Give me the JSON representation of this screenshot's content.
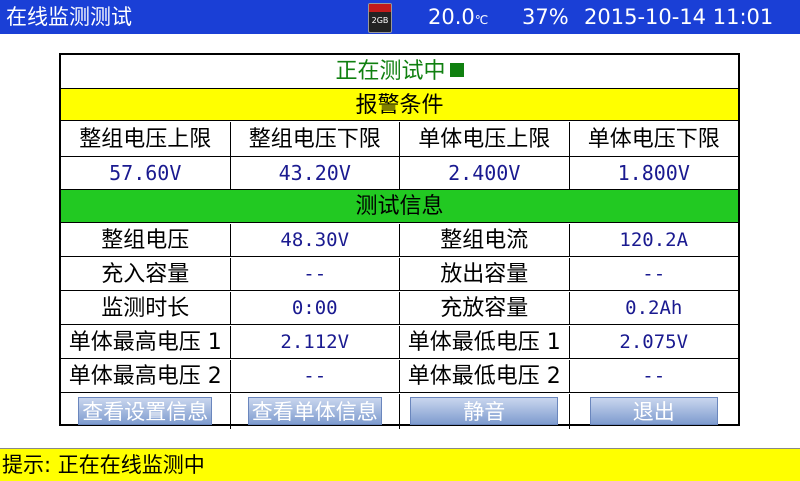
{
  "header": {
    "title": "在线监测测试",
    "temperature": "20.0",
    "temperature_unit": "℃",
    "humidity": "37%",
    "datetime": "2015-10-14 11:01",
    "sd_card_label": "2GB"
  },
  "status": {
    "text": "正在测试中",
    "indicator_color": "#108010"
  },
  "alarm_section": {
    "title": "报警条件",
    "headers": [
      "整组电压上限",
      "整组电压下限",
      "单体电压上限",
      "单体电压下限"
    ],
    "values": [
      "57.60V",
      "43.20V",
      "2.400V",
      "1.800V"
    ]
  },
  "test_info_section": {
    "title": "测试信息",
    "rows": [
      {
        "label1": "整组电压",
        "value1": "48.30V",
        "label2": "整组电流",
        "value2": "120.2A"
      },
      {
        "label1": "充入容量",
        "value1": "--",
        "label2": "放出容量",
        "value2": "--"
      },
      {
        "label1": "监测时长",
        "value1": "0:00",
        "label2": "充放容量",
        "value2": "0.2Ah"
      },
      {
        "label1": "单体最高电压 1",
        "value1": "2.112V",
        "label2": "单体最低电压 1",
        "value2": "2.075V"
      },
      {
        "label1": "单体最高电压 2",
        "value1": "--",
        "label2": "单体最低电压 2",
        "value2": "--"
      }
    ]
  },
  "buttons": {
    "view_settings": "查看设置信息",
    "view_cells": "查看单体信息",
    "mute": "静音",
    "exit": "退出"
  },
  "footer": {
    "hint": "提示: 正在在线监测中"
  },
  "colors": {
    "title_bar": "#1a3fd6",
    "alarm_band": "#ffff00",
    "info_band": "#22c922",
    "footer_bar": "#ffff00"
  }
}
